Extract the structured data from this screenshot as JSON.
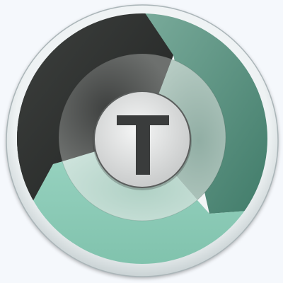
{
  "icon": {
    "name": "teracopy-logo",
    "letter": "T"
  },
  "colors": {
    "background": "#f5f8fc",
    "outer_rim": "#e7edef",
    "rim_shadow": "#aeb9bc",
    "dark_segment": "#373a38",
    "dark_segment_light": "#6a6d6b",
    "teal_segment": "#5e9584",
    "teal_segment_light": "#a6c1b8",
    "mint_segment": "#8ccab6",
    "mint_segment_light": "#c3dfd6",
    "center_disc": "#e5e6e6",
    "letter": "#3a3c3c"
  }
}
